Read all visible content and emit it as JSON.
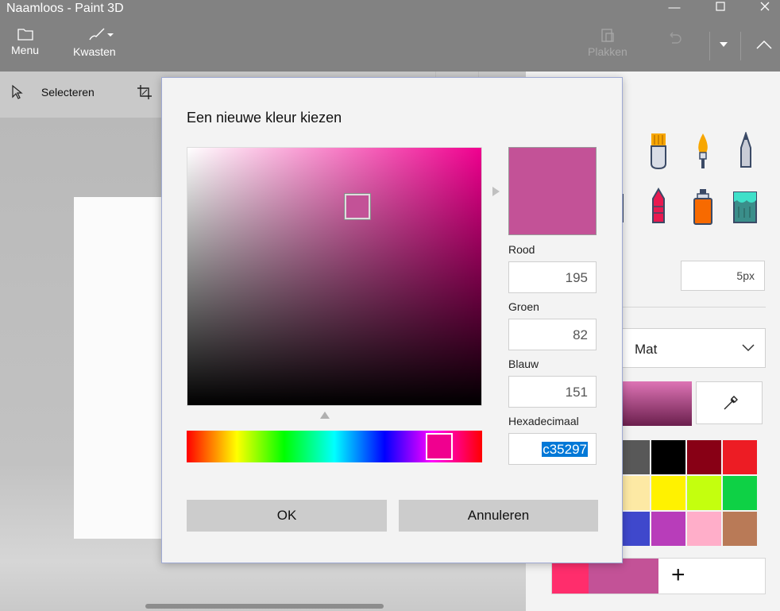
{
  "window": {
    "title": "Naamloos - Paint 3D",
    "controls": [
      "minimize-icon",
      "maximize-icon",
      "close-icon"
    ]
  },
  "ribbon": {
    "menu_label": "Menu",
    "brushes_label": "Kwasten",
    "paste_label": "Plakken"
  },
  "toolbar": {
    "select_label": "Selecteren"
  },
  "panel": {
    "brushes": [
      "marker-icon",
      "calligraphy-pen-icon",
      "oil-brush-icon",
      "watercolor-icon",
      "pencil-icon",
      "eraser-icon",
      "crayon-icon",
      "spray-can-icon",
      "fill-bucket-icon"
    ],
    "thickness_value": "5px",
    "finish_value": "Mat",
    "palette": [
      "#585858",
      "#000000",
      "#880015",
      "#ed1c24",
      "#fde9a4",
      "#fff200",
      "#c4ff0e",
      "#0ed145",
      "#3f48cc",
      "#b83dba",
      "#ffaec9",
      "#b97a57"
    ],
    "custom_colors": [
      "#ff2d6c",
      "#c35297"
    ],
    "add_symbol": "+"
  },
  "dialog": {
    "title": "Een nieuwe kleur kiezen",
    "current_color": "#c35297",
    "hue_color": "#f0008f",
    "red_label": "Rood",
    "red_value": "195",
    "green_label": "Groen",
    "green_value": "82",
    "blue_label": "Blauw",
    "blue_value": "151",
    "hex_label": "Hexadecimaal",
    "hex_value": "c35297",
    "ok_label": "OK",
    "cancel_label": "Annuleren"
  }
}
